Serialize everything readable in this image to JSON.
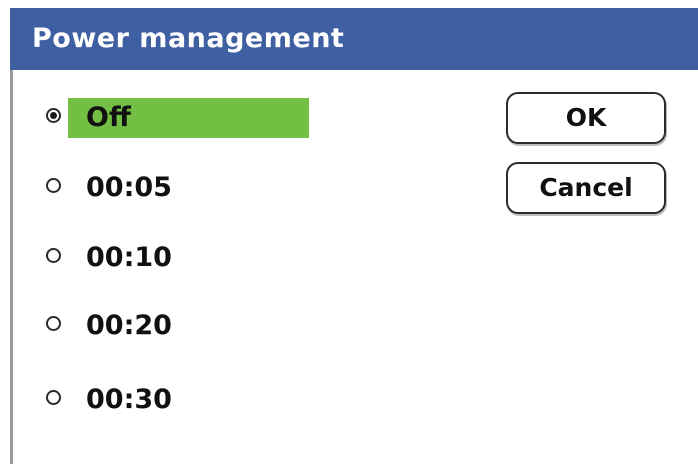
{
  "dialog": {
    "title": "Power management",
    "options": [
      {
        "label": "Off",
        "selected": true
      },
      {
        "label": "00:05",
        "selected": false
      },
      {
        "label": "00:10",
        "selected": false
      },
      {
        "label": "00:20",
        "selected": false
      },
      {
        "label": "00:30",
        "selected": false
      }
    ],
    "buttons": {
      "ok_label": "OK",
      "cancel_label": "Cancel"
    }
  },
  "colors": {
    "title_bar": "#3f5fa3",
    "selection_highlight": "#72bf44"
  }
}
